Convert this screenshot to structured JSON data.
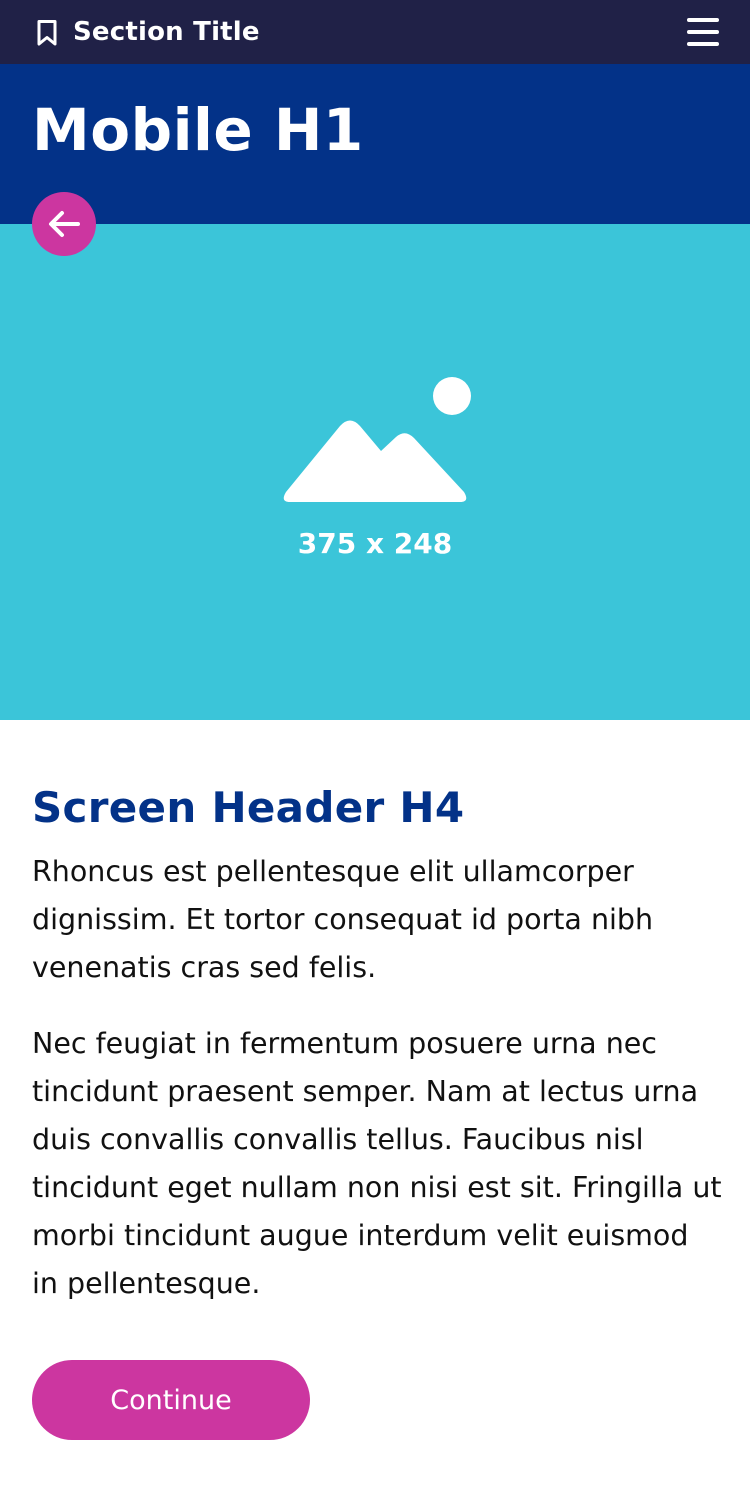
{
  "header": {
    "section_title": "Section Title",
    "bookmark_icon": "bookmark-icon",
    "menu_icon": "hamburger-menu-icon"
  },
  "hero": {
    "title": "Mobile H1",
    "back_icon": "arrow-left-icon"
  },
  "media": {
    "icon": "image-placeholder-icon",
    "dimensions_label": "375 x 248"
  },
  "content": {
    "heading": "Screen Header H4",
    "paragraphs": [
      "Rhoncus est pellentesque elit ullamcorper dignissim. Et tortor consequat id porta nibh venenatis cras sed felis.",
      "Nec feugiat in fermentum posuere urna nec tincidunt praesent semper. Nam at lectus urna duis convallis convallis tellus. Faucibus nisl tincidunt eget nullam non nisi est sit. Fringilla ut morbi tincidunt augue interdum velit euismod in pellentesque."
    ]
  },
  "actions": {
    "continue_label": "Continue"
  },
  "colors": {
    "topbar": "#202147",
    "hero": "#033288",
    "media": "#3bc5d9",
    "accent": "#cc36a0",
    "heading": "#033288"
  }
}
